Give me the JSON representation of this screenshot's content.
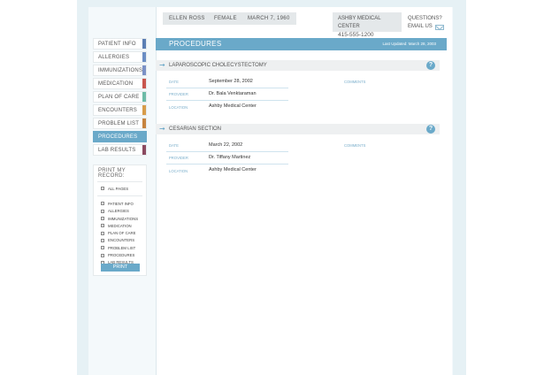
{
  "header": {
    "patient_name": "ELLEN ROSS",
    "sex": "FEMALE",
    "dob": "MARCH 7, 1960",
    "provider_office": "ASHBY MEDICAL CENTER",
    "phone": "415-555-1200",
    "questions_label": "QUESTIONS?",
    "email_label": "EMAIL US"
  },
  "nav": {
    "items": [
      {
        "label": "PATIENT INFO",
        "color": "#5c7fb4"
      },
      {
        "label": "ALLERGIES",
        "color": "#6a8dc4"
      },
      {
        "label": "IMMUNIZATIONS",
        "color": "#7b91c6"
      },
      {
        "label": "MEDICATION",
        "color": "#c8564e"
      },
      {
        "label": "PLAN OF CARE",
        "color": "#6dbba7"
      },
      {
        "label": "ENCOUNTERS",
        "color": "#d79c4a"
      },
      {
        "label": "PROBLEM LIST",
        "color": "#c6843f"
      },
      {
        "label": "PROCEDURES",
        "color": "#6aa9c9"
      },
      {
        "label": "LAB RESULTS",
        "color": "#8b4a60"
      }
    ],
    "active": "PROCEDURES"
  },
  "print": {
    "title": "PRINT MY RECORD:",
    "all_pages": "ALL PAGES",
    "options": [
      "PATIENT INFO",
      "ALLERGIES",
      "IMMUNIZATIONS",
      "MEDICATION",
      "PLAN OF CARE",
      "ENCOUNTERS",
      "PROBLEM LIST",
      "PROCEDURES",
      "LAB RESULTS"
    ],
    "button": "PRINT"
  },
  "section": {
    "title": "PROCEDURES",
    "last_updated": "Last Updated: March 28, 2003"
  },
  "labels": {
    "date": "DATE",
    "provider": "PROVIDER",
    "location": "LOCATION",
    "comments": "COMMENTS"
  },
  "procedures": [
    {
      "name": "LAPAROSCOPIC CHOLECYSTECTOMY",
      "date": "September 28, 2002",
      "provider": "Dr. Bala Venktaraman",
      "location": "Ashby Medical Center"
    },
    {
      "name": "CESARIAN SECTION",
      "date": "March 22, 2002",
      "provider": "Dr. Tiffany Martinez",
      "location": "Ashby Medical Center"
    }
  ]
}
